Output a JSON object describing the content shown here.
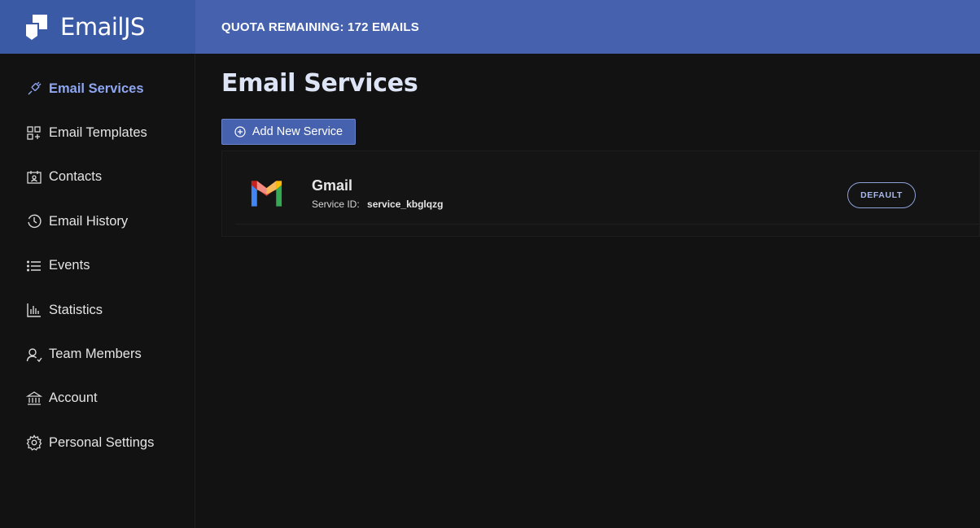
{
  "brand": {
    "name": "EmailJS"
  },
  "topbar": {
    "quota": "QUOTA REMAINING: 172 EMAILS"
  },
  "sidebar": {
    "items": [
      {
        "label": "Email Services",
        "icon": "plug-icon",
        "active": true
      },
      {
        "label": "Email Templates",
        "icon": "templates-icon",
        "active": false
      },
      {
        "label": "Contacts",
        "icon": "contacts-icon",
        "active": false
      },
      {
        "label": "Email History",
        "icon": "history-icon",
        "active": false
      },
      {
        "label": "Events",
        "icon": "list-icon",
        "active": false
      },
      {
        "label": "Statistics",
        "icon": "bar-chart-icon",
        "active": false
      },
      {
        "label": "Team Members",
        "icon": "team-icon",
        "active": false
      },
      {
        "label": "Account",
        "icon": "bank-icon",
        "active": false
      },
      {
        "label": "Personal Settings",
        "icon": "gear-icon",
        "active": false
      }
    ]
  },
  "main": {
    "title": "Email Services",
    "add_button": "Add New Service",
    "services": [
      {
        "name": "Gmail",
        "id_label": "Service ID:",
        "id_value": "service_kbglqzg",
        "badge": "DEFAULT",
        "icon": "gmail-logo-icon"
      }
    ]
  },
  "colors": {
    "topbar": "#4662ae",
    "logo_area": "#3a5aa6",
    "background": "#121212",
    "active_nav": "#8fa6f0"
  }
}
